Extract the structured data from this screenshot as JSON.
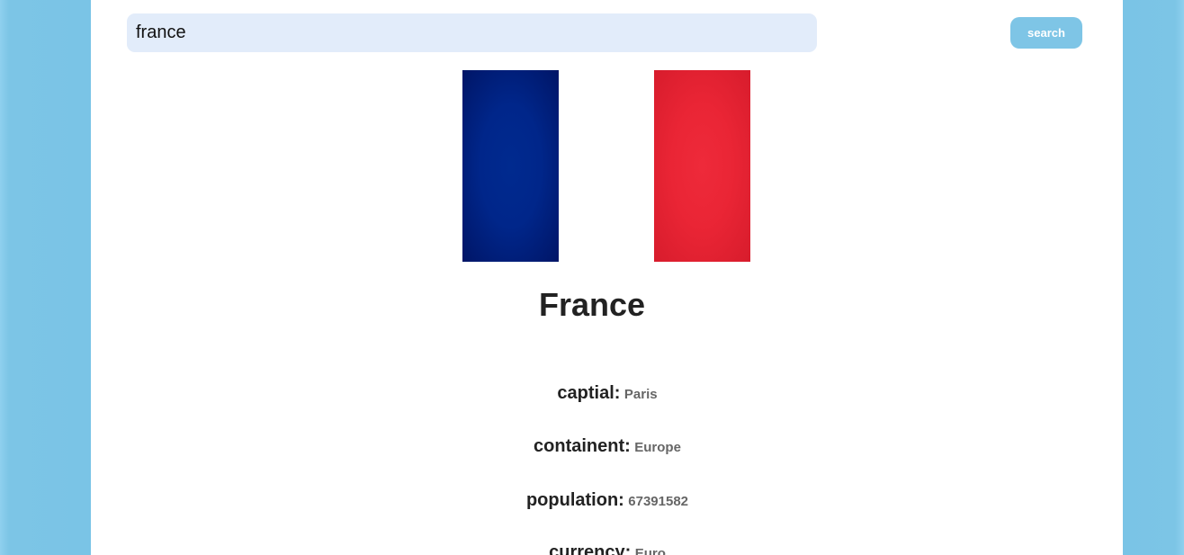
{
  "search": {
    "value": "france",
    "button_label": "search"
  },
  "flag": {
    "colors": [
      "#002395",
      "#ffffff",
      "#ed2939"
    ]
  },
  "country": {
    "name": "France"
  },
  "info": [
    {
      "label": "captial:",
      "value": "Paris"
    },
    {
      "label": "containent:",
      "value": "Europe"
    },
    {
      "label": "population:",
      "value": "67391582"
    },
    {
      "label": "currency:",
      "value": "Euro"
    }
  ]
}
